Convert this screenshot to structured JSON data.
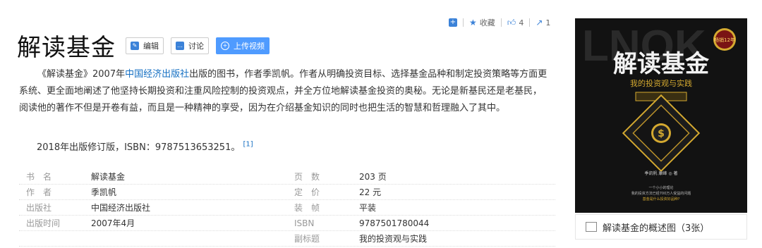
{
  "toolbar": {
    "favorite_label": "收藏",
    "like_count": "4",
    "share_count": "1"
  },
  "title": "解读基金",
  "buttons": {
    "edit": "编辑",
    "discuss": "讨论",
    "upload_video": "上传视频"
  },
  "summary": {
    "part1": "《解读基金》2007年",
    "publisher_link": "中国经济出版社",
    "part2": "出版的图书，作者季凯帆。作者从明确投资目标、选择基金品种和制定投资策略等方面更系统、更全面地阐述了他坚持长期投资和注重风险控制的投资观点，并全方位地解读基金投资的奥秘。无论是新基民还是老基民，阅读他的著作不但是开卷有益，而且是一种精神的享受，因为在介绍基金知识的同时也把生活的智慧和哲理融入了其中。"
  },
  "isbn_line": {
    "text": "2018年出版修订版，ISBN：9787513653251。",
    "ref": "[1]"
  },
  "info": [
    {
      "k1": "书　名",
      "v1": "解读基金",
      "k2": "页　数",
      "v2": "203 页"
    },
    {
      "k1": "作　者",
      "v1": "季凯帆",
      "k2": "定　价",
      "v2": "22 元"
    },
    {
      "k1": "出版社",
      "v1": "中国经济出版社",
      "k2": "装　帧",
      "v2": "平装"
    },
    {
      "k1": "出版时间",
      "v1": "2007年4月",
      "k2": "ISBN",
      "v2": "9787501780044"
    },
    {
      "k1": "",
      "v1": "",
      "k2": "副标题",
      "v2": "我的投资观与实践"
    }
  ],
  "cover": {
    "title": "解读基金",
    "subtitle": "我的投资观与实践",
    "badge": "畅销12年",
    "author": "季凯帆 康峰 ◎ 著",
    "tagline1": "一个小小的理论",
    "tagline2": "我的投资方法已经700万人受益的问题",
    "tagline3": "基金是什么投资好品种?"
  },
  "caption": "解读基金的概述图（3张）",
  "colors": {
    "link": "#136ec2",
    "accent": "#3b82d8",
    "gold": "#d4a930"
  }
}
